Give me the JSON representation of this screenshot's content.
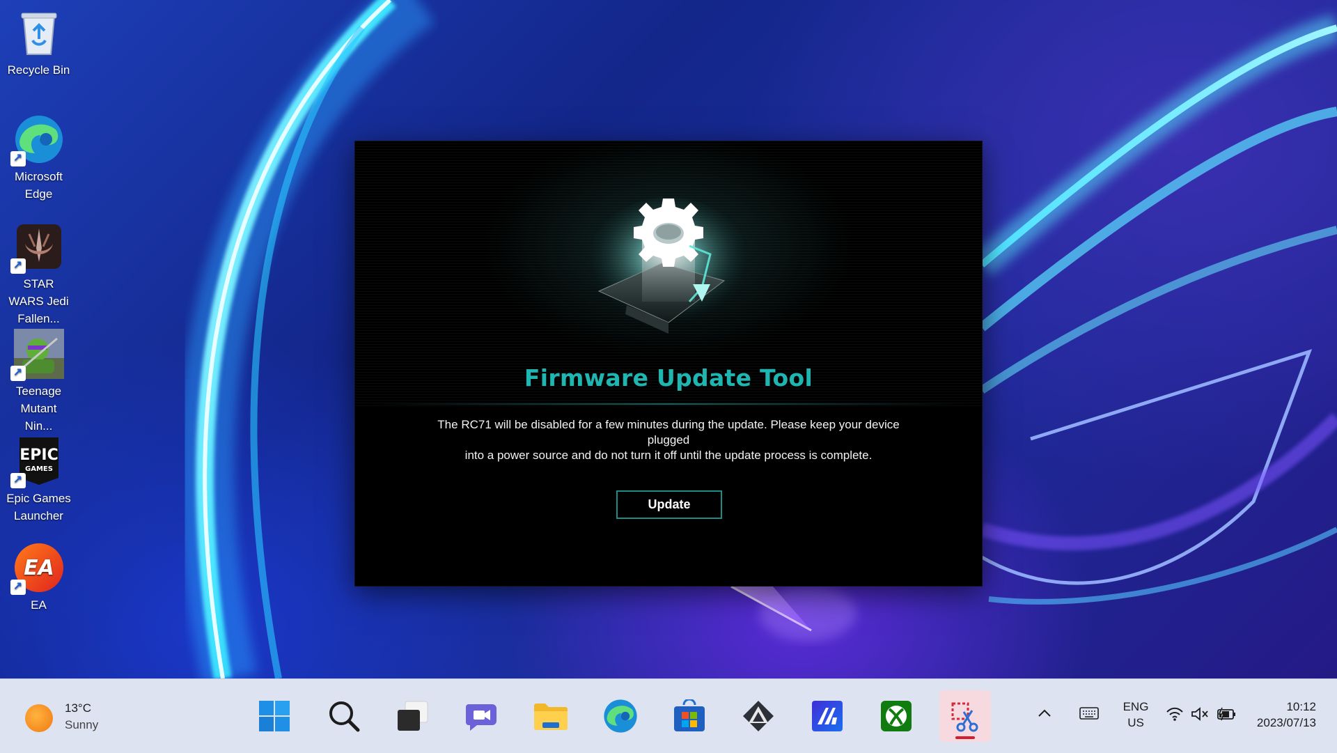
{
  "desktop": {
    "icons": [
      {
        "label": "Recycle Bin",
        "icon": "recycle-bin-icon"
      },
      {
        "label": "Microsoft Edge",
        "icon": "edge-icon"
      },
      {
        "label": "STAR WARS Jedi Fallen...",
        "icon": "jedi-order-icon"
      },
      {
        "label": "Teenage Mutant Nin...",
        "icon": "tmnt-icon"
      },
      {
        "label": "Epic Games Launcher",
        "icon": "epic-games-icon"
      },
      {
        "label": "EA",
        "icon": "ea-icon"
      }
    ]
  },
  "dialog": {
    "title": "Firmware Update Tool",
    "message_line1": "The RC71 will be disabled for a few minutes during the update. Please keep your device plugged",
    "message_line2": "into a power source and do not turn it off until the update process is complete.",
    "update_label": "Update",
    "accent_color": "#1fb5b0"
  },
  "taskbar": {
    "weather": {
      "temp": "13°C",
      "condition": "Sunny",
      "icon": "sun-icon"
    },
    "apps": [
      {
        "name": "Start",
        "icon": "windows-start-icon"
      },
      {
        "name": "Search",
        "icon": "search-icon"
      },
      {
        "name": "Task View",
        "icon": "task-view-icon"
      },
      {
        "name": "Chat",
        "icon": "teams-chat-icon"
      },
      {
        "name": "File Explorer",
        "icon": "folder-icon"
      },
      {
        "name": "Microsoft Edge",
        "icon": "edge-icon"
      },
      {
        "name": "Microsoft Store",
        "icon": "store-icon"
      },
      {
        "name": "Armoury Crate",
        "icon": "armoury-crate-icon"
      },
      {
        "name": "MyASUS",
        "icon": "myasus-icon"
      },
      {
        "name": "Xbox",
        "icon": "xbox-icon"
      },
      {
        "name": "Snipping Tool",
        "icon": "snipping-tool-icon",
        "active": true
      }
    ],
    "tray": {
      "lang_top": "ENG",
      "lang_bottom": "US",
      "time": "10:12",
      "date": "2023/07/13"
    }
  }
}
